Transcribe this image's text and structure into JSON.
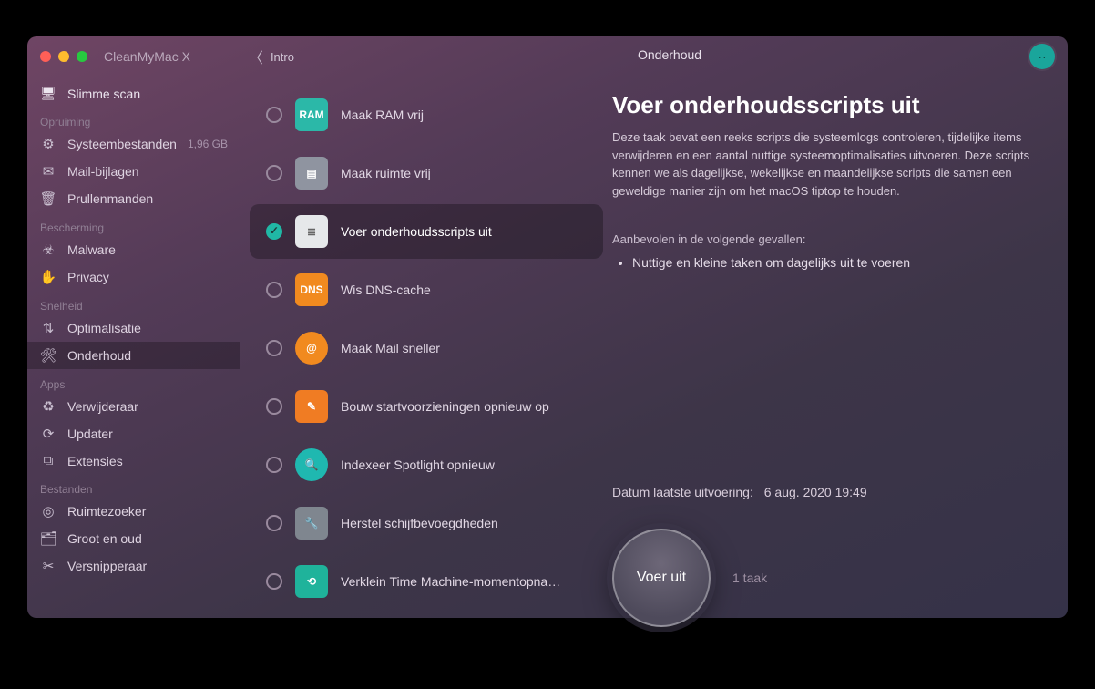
{
  "app": {
    "title": "CleanMyMac X"
  },
  "titlebar": {
    "back_label": "Intro",
    "detail_title": "Onderhoud",
    "profile_glyph": "··"
  },
  "sidebar": {
    "top_item": "Slimme scan",
    "sections": [
      {
        "title": "Opruiming",
        "items": [
          {
            "icon": "⚙",
            "label": "Systeembestanden",
            "badge": "1,96 GB"
          },
          {
            "icon": "✉",
            "label": "Mail-bijlagen"
          },
          {
            "icon": "🗑",
            "label": "Prullenmanden"
          }
        ]
      },
      {
        "title": "Bescherming",
        "items": [
          {
            "icon": "☣",
            "label": "Malware"
          },
          {
            "icon": "✋",
            "label": "Privacy"
          }
        ]
      },
      {
        "title": "Snelheid",
        "items": [
          {
            "icon": "⇅",
            "label": "Optimalisatie"
          },
          {
            "icon": "🛠",
            "label": "Onderhoud",
            "active": true
          }
        ]
      },
      {
        "title": "Apps",
        "items": [
          {
            "icon": "♻",
            "label": "Verwijderaar"
          },
          {
            "icon": "⟳",
            "label": "Updater"
          },
          {
            "icon": "⧉",
            "label": "Extensies"
          }
        ]
      },
      {
        "title": "Bestanden",
        "items": [
          {
            "icon": "◎",
            "label": "Ruimtezoeker"
          },
          {
            "icon": "🗂",
            "label": "Groot en oud"
          },
          {
            "icon": "✂",
            "label": "Versnipperaar"
          }
        ]
      }
    ]
  },
  "tasks": [
    {
      "icon_class": "ti-ram",
      "icon_text": "RAM",
      "label": "Maak RAM vrij"
    },
    {
      "icon_class": "ti-disk",
      "icon_text": "▤",
      "label": "Maak ruimte vrij"
    },
    {
      "icon_class": "ti-script",
      "icon_text": "≣",
      "label": "Voer onderhoudsscripts uit",
      "selected": true
    },
    {
      "icon_class": "ti-dns",
      "icon_text": "DNS",
      "label": "Wis DNS-cache"
    },
    {
      "icon_class": "ti-mail",
      "icon_text": "@",
      "label": "Maak Mail sneller"
    },
    {
      "icon_class": "ti-boot",
      "icon_text": "✎",
      "label": "Bouw startvoorzieningen opnieuw op"
    },
    {
      "icon_class": "ti-spot",
      "icon_text": "🔍",
      "label": "Indexeer Spotlight opnieuw"
    },
    {
      "icon_class": "ti-perm",
      "icon_text": "🔧",
      "label": "Herstel schijfbevoegdheden"
    },
    {
      "icon_class": "ti-tm",
      "icon_text": "⟲",
      "label": "Verklein Time Machine-momentopnam…"
    }
  ],
  "detail": {
    "heading": "Voer onderhoudsscripts uit",
    "description": "Deze taak bevat een reeks scripts die systeemlogs controleren, tijdelijke items verwijderen en een aantal nuttige systeemoptimalisaties uitvoeren. Deze scripts kennen we als dagelijkse, wekelijkse en maandelijkse scripts die samen een geweldige manier zijn om het macOS tiptop te houden.",
    "recommend_heading": "Aanbevolen in de volgende gevallen:",
    "recommend_items": [
      "Nuttige en kleine taken om dagelijks uit te voeren"
    ],
    "lastrun_label": "Datum laatste uitvoering:",
    "lastrun_value": "6 aug. 2020 19:49",
    "run_button": "Voer uit",
    "task_count": "1 taak"
  }
}
